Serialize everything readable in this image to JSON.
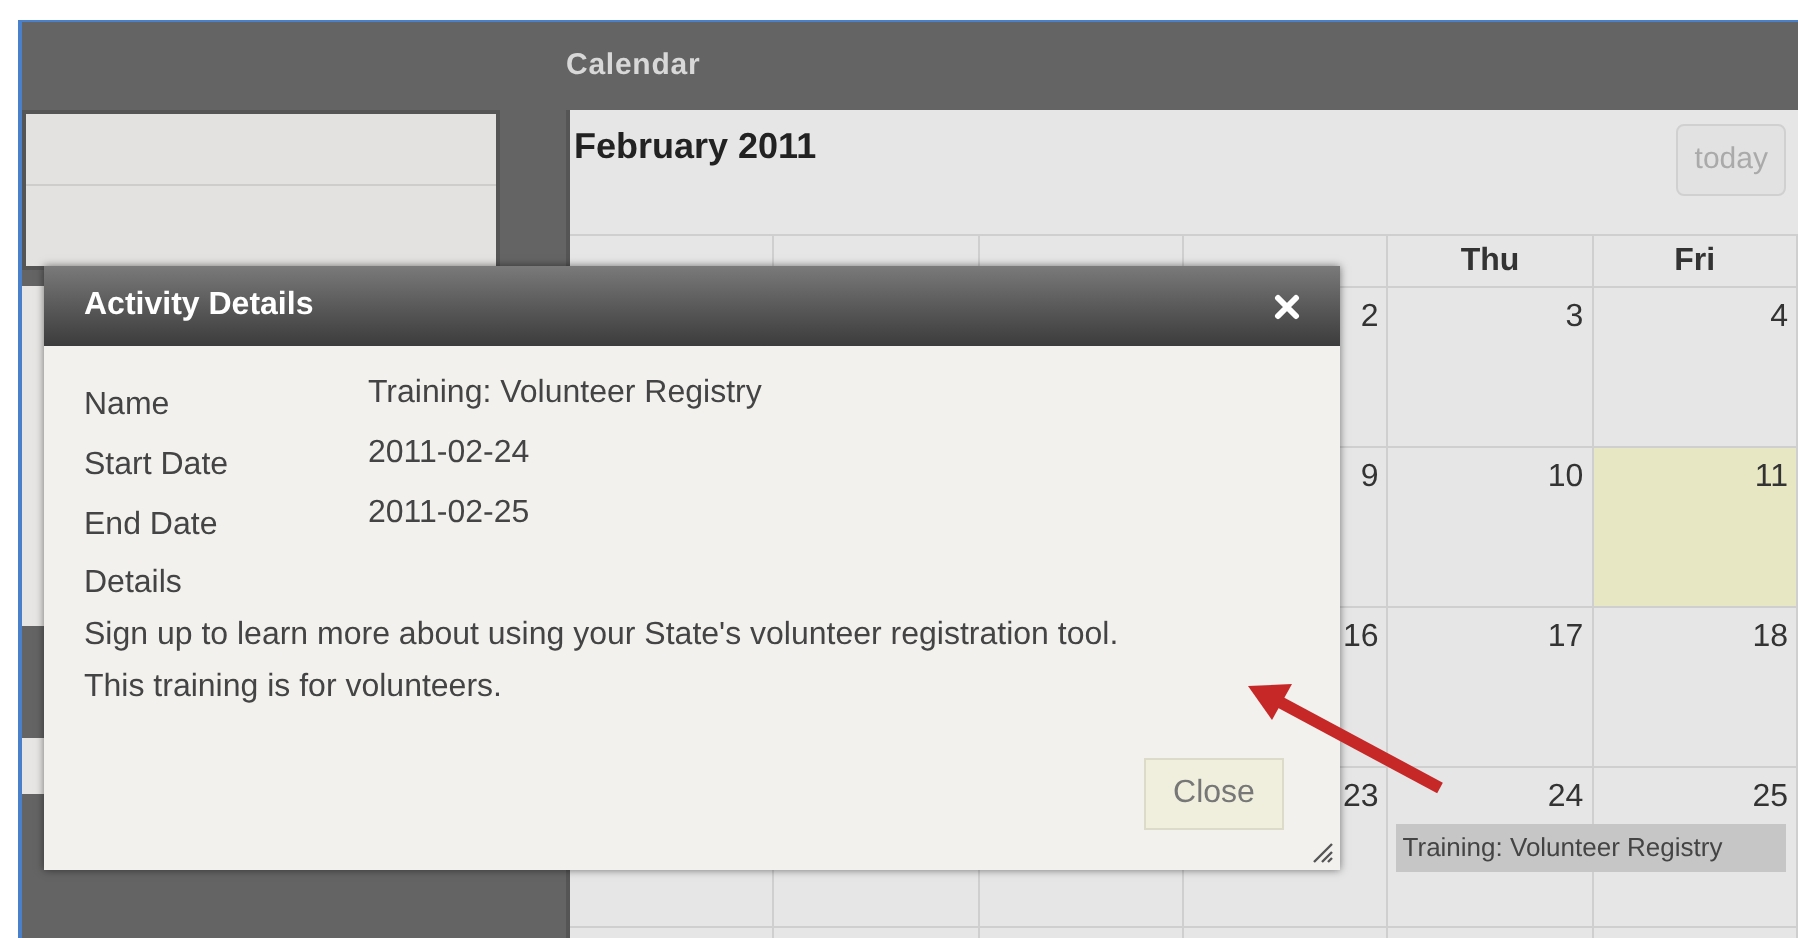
{
  "calendar": {
    "title": "Calendar",
    "month": "February 2011",
    "today_button": "today",
    "columns": [
      {
        "label": "Thu"
      },
      {
        "label": "Fri"
      }
    ],
    "weeks": [
      {
        "cells": [
          {
            "day": "2",
            "today": false
          },
          {
            "day": "3",
            "today": false
          },
          {
            "day": "4",
            "today": false
          }
        ]
      },
      {
        "cells": [
          {
            "day": "9",
            "today": false
          },
          {
            "day": "10",
            "today": false
          },
          {
            "day": "11",
            "today": true
          }
        ]
      },
      {
        "cells": [
          {
            "day": "16",
            "today": false
          },
          {
            "day": "17",
            "today": false
          },
          {
            "day": "18",
            "today": false
          }
        ]
      },
      {
        "cells": [
          {
            "day": "23",
            "today": false
          },
          {
            "day": "24",
            "today": false
          },
          {
            "day": "25",
            "today": false
          }
        ],
        "event": {
          "title": "Training: Volunteer Registry"
        }
      }
    ]
  },
  "dialog": {
    "title": "Activity Details",
    "fields": [
      {
        "label": "Name",
        "value": "Training: Volunteer Registry"
      },
      {
        "label": "Start Date",
        "value": "2011-02-24"
      },
      {
        "label": "End Date",
        "value": "2011-02-25"
      }
    ],
    "details_label": "Details",
    "details_lines": [
      "Sign up to learn more about using your State's volunteer registration tool.",
      "This training is for volunteers."
    ],
    "close_button": "Close"
  }
}
